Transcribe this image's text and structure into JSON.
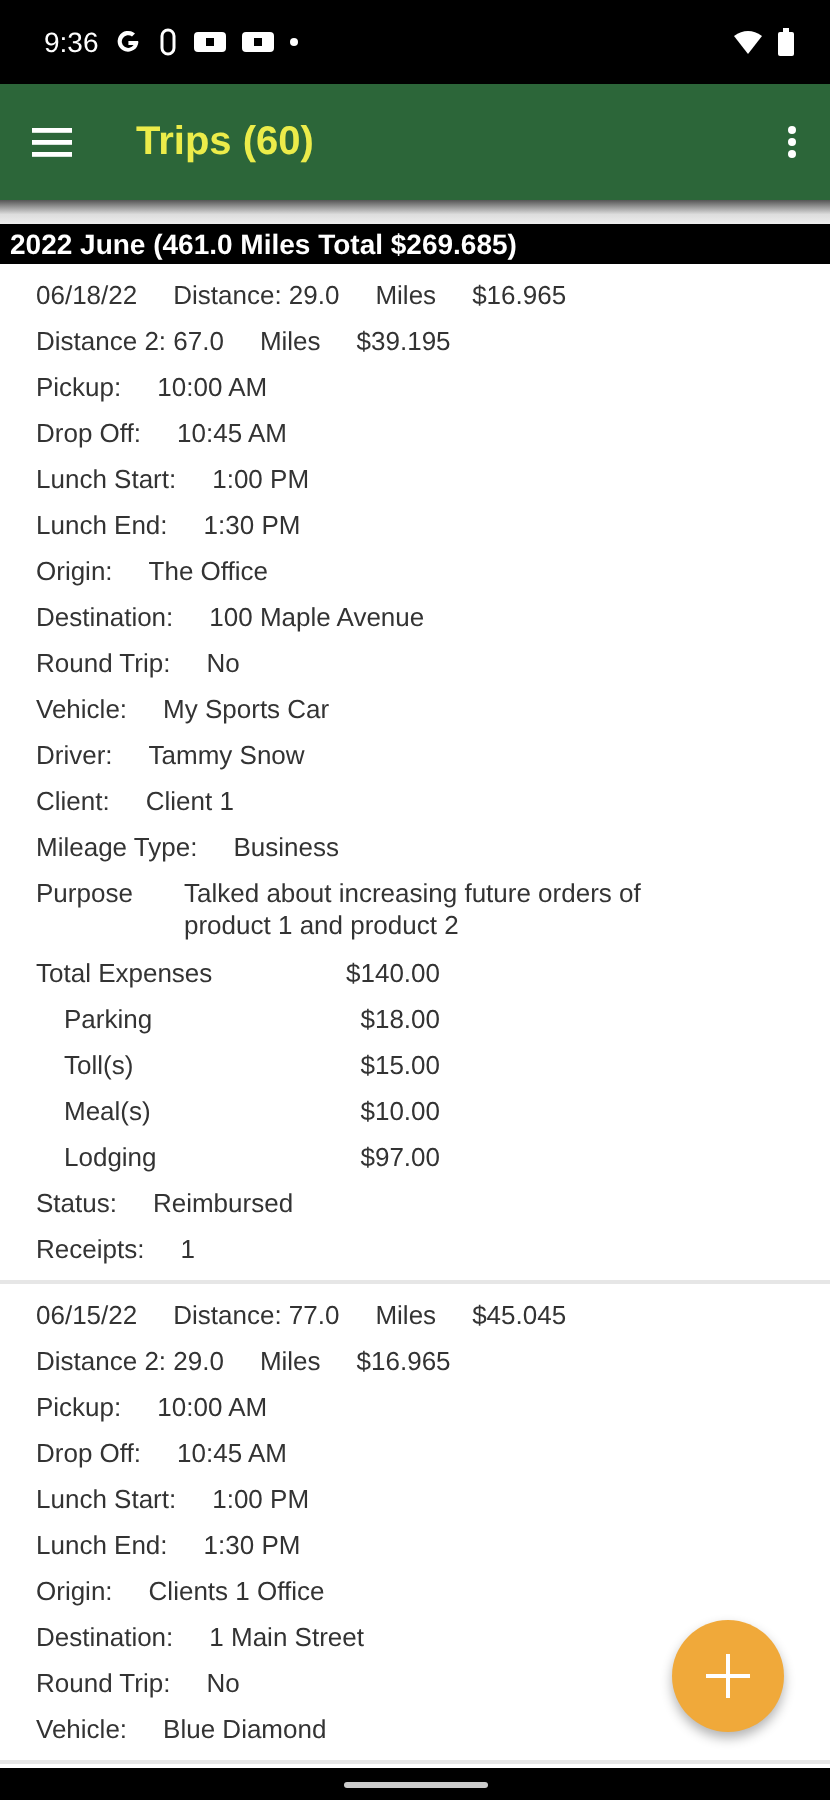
{
  "status_bar": {
    "time": "9:36"
  },
  "app_bar": {
    "title": "Trips (60)"
  },
  "group_header": "2022 June (461.0 Miles Total $269.685)",
  "trips": [
    {
      "rows": [
        {
          "kind": "cells",
          "cells": [
            "06/18/22",
            "Distance: 29.0",
            "Miles",
            "$16.965"
          ]
        },
        {
          "kind": "cells",
          "cells": [
            "Distance 2: 67.0",
            "Miles",
            "$39.195"
          ]
        },
        {
          "kind": "field",
          "label": "Pickup:",
          "value": "10:00 AM"
        },
        {
          "kind": "field",
          "label": "Drop Off:",
          "value": "10:45 AM"
        },
        {
          "kind": "field",
          "label": "Lunch Start:",
          "value": "1:00 PM"
        },
        {
          "kind": "field",
          "label": "Lunch End:",
          "value": "1:30 PM"
        },
        {
          "kind": "field",
          "label": "Origin:",
          "value": "The Office"
        },
        {
          "kind": "field",
          "label": "Destination:",
          "value": "100 Maple Avenue"
        },
        {
          "kind": "field",
          "label": "Round Trip:",
          "value": "No"
        },
        {
          "kind": "field",
          "label": "Vehicle:",
          "value": "My Sports Car"
        },
        {
          "kind": "field",
          "label": "Driver:",
          "value": "Tammy Snow"
        },
        {
          "kind": "field",
          "label": "Client:",
          "value": "Client 1"
        },
        {
          "kind": "field",
          "label": "Mileage Type:",
          "value": "Business"
        },
        {
          "kind": "note",
          "label": "Purpose",
          "value": "Talked about increasing future orders of product 1 and product 2"
        },
        {
          "kind": "expense",
          "label": "Total Expenses",
          "value": "$140.00",
          "indented": false
        },
        {
          "kind": "expense",
          "label": "Parking",
          "value": "$18.00",
          "indented": true
        },
        {
          "kind": "expense",
          "label": "Toll(s)",
          "value": "$15.00",
          "indented": true
        },
        {
          "kind": "expense",
          "label": "Meal(s)",
          "value": "$10.00",
          "indented": true
        },
        {
          "kind": "expense",
          "label": "Lodging",
          "value": "$97.00",
          "indented": true
        },
        {
          "kind": "field",
          "label": "Status:",
          "value": "Reimbursed"
        },
        {
          "kind": "field",
          "label": "Receipts:",
          "value": "1"
        }
      ]
    },
    {
      "rows": [
        {
          "kind": "cells",
          "cells": [
            "06/15/22",
            "Distance: 77.0",
            "Miles",
            "$45.045"
          ]
        },
        {
          "kind": "cells",
          "cells": [
            "Distance 2: 29.0",
            "Miles",
            "$16.965"
          ]
        },
        {
          "kind": "field",
          "label": "Pickup:",
          "value": "10:00 AM"
        },
        {
          "kind": "field",
          "label": "Drop Off:",
          "value": "10:45 AM"
        },
        {
          "kind": "field",
          "label": "Lunch Start:",
          "value": "1:00 PM"
        },
        {
          "kind": "field",
          "label": "Lunch End:",
          "value": "1:30 PM"
        },
        {
          "kind": "field",
          "label": "Origin:",
          "value": "Clients 1 Office"
        },
        {
          "kind": "field",
          "label": "Destination:",
          "value": "1 Main Street"
        },
        {
          "kind": "field",
          "label": "Round Trip:",
          "value": "No"
        },
        {
          "kind": "field",
          "label": "Vehicle:",
          "value": "Blue Diamond"
        }
      ]
    }
  ]
}
